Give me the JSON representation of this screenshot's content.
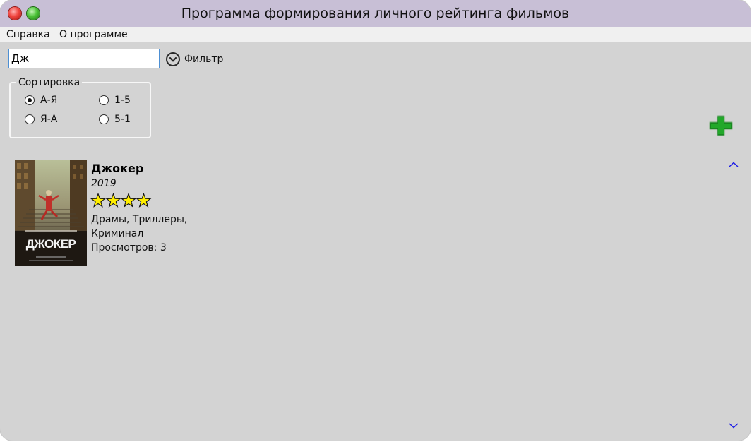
{
  "window": {
    "title": "Программа формирования личного рейтинга фильмов"
  },
  "menu": {
    "items": [
      {
        "label": "Справка"
      },
      {
        "label": "О программе"
      }
    ]
  },
  "search": {
    "value": "Дж"
  },
  "filter": {
    "label": "Фильтр",
    "icon": "chevron-down-icon"
  },
  "sort": {
    "legend": "Сортировка",
    "options": [
      {
        "label": "А-Я",
        "checked": true
      },
      {
        "label": "1-5",
        "checked": false
      },
      {
        "label": "Я-А",
        "checked": false
      },
      {
        "label": "5-1",
        "checked": false
      }
    ]
  },
  "add_button": {
    "icon": "plus-icon",
    "color": "#1a8f1a"
  },
  "scroll": {
    "up_icon": "chevron-up-icon",
    "down_icon": "chevron-down-icon",
    "color": "#1a1ae6"
  },
  "movies": [
    {
      "poster_text": "ДЖОКЕР",
      "title": "Джокер",
      "year": "2019",
      "rating": 4,
      "rating_max": 4,
      "genres": "Драмы, Триллеры, Криминал",
      "views": "Просмотров: 3"
    }
  ],
  "colors": {
    "titlebar": "#c8bfd6",
    "background": "#d3d3d3",
    "menubar": "#f0f0f0",
    "star_fill": "#ffee00"
  }
}
